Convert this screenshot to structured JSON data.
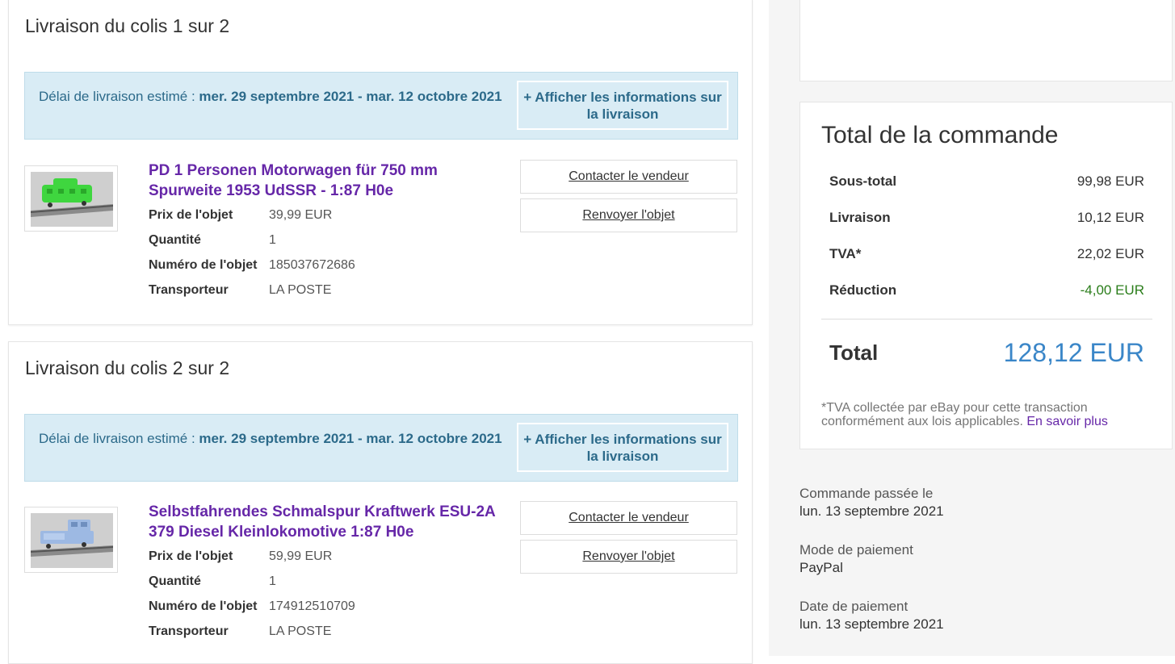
{
  "packages": [
    {
      "title": "Livraison du colis 1 sur 2",
      "delivery_prefix": "Délai de livraison estimé : ",
      "delivery_dates": "mer. 29 septembre 2021 - mar. 12 octobre 2021",
      "show_info_label": "+ Afficher les informations sur la livraison",
      "item": {
        "title": "PD 1 Personen Motorwagen für 750 mm Spurweite 1953 UdSSR - 1:87 H0e",
        "price_label": "Prix de l'objet",
        "price": "39,99 EUR",
        "qty_label": "Quantité",
        "qty": "1",
        "number_label": "Numéro de l'objet",
        "number": "185037672686",
        "carrier_label": "Transporteur",
        "carrier": "LA POSTE",
        "thumb_color": "#3fd63f"
      },
      "contact_label": "Contacter le vendeur",
      "return_label": "Renvoyer l'objet"
    },
    {
      "title": "Livraison du colis 2 sur 2",
      "delivery_prefix": "Délai de livraison estimé : ",
      "delivery_dates": "mer. 29 septembre 2021 - mar. 12 octobre 2021",
      "show_info_label": "+ Afficher les informations sur la livraison",
      "item": {
        "title": "Selbstfahrendes Schmalspur Kraftwerk ESU-2A 379 Diesel Kleinlokomotive 1:87 H0e",
        "price_label": "Prix de l'objet",
        "price": "59,99 EUR",
        "qty_label": "Quantité",
        "qty": "1",
        "number_label": "Numéro de l'objet",
        "number": "174912510709",
        "carrier_label": "Transporteur",
        "carrier": "LA POSTE",
        "thumb_color": "#9db9e3"
      },
      "contact_label": "Contacter le vendeur",
      "return_label": "Renvoyer l'objet"
    }
  ],
  "summary": {
    "title": "Total de la commande",
    "subtotal_label": "Sous-total",
    "subtotal": "99,98 EUR",
    "shipping_label": "Livraison",
    "shipping": "10,12 EUR",
    "vat_label": "TVA*",
    "vat": "22,02 EUR",
    "discount_label": "Réduction",
    "discount": "-4,00 EUR",
    "total_label": "Total",
    "total": "128,12 EUR",
    "vat_note": "*TVA collectée par eBay pour cette transaction conformément aux lois applicables. ",
    "learn_more": "En savoir plus"
  },
  "order_meta": {
    "placed_label": "Commande passée le",
    "placed_date": "lun. 13 septembre 2021",
    "payment_method_label": "Mode de paiement",
    "payment_method": "PayPal",
    "payment_date_label": "Date de paiement",
    "payment_date": "lun. 13 septembre 2021"
  },
  "colors": {
    "link_purple": "#6627a8",
    "total_blue": "#3a86c8",
    "discount_green": "#2a7d1a",
    "banner_bg": "#d9ecf5"
  }
}
